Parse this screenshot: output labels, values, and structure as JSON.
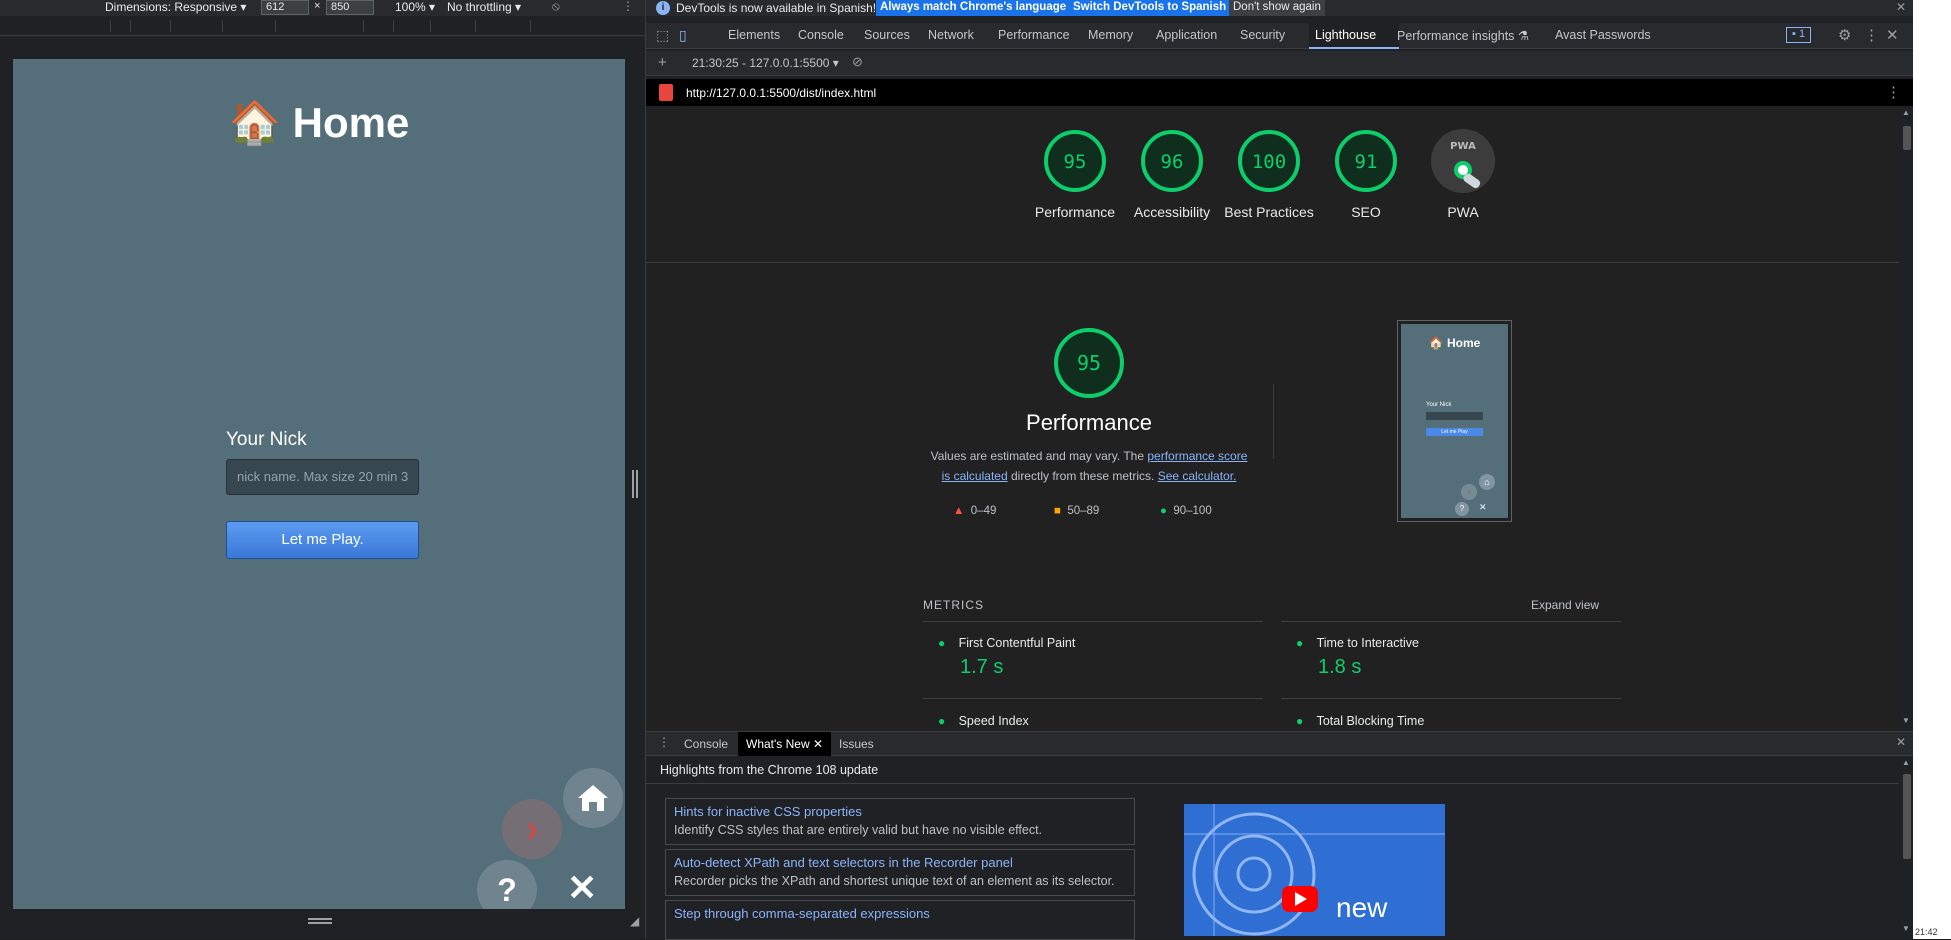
{
  "emulation": {
    "dimensions_label": "Dimensions: Responsive",
    "width_value": "612",
    "times": "×",
    "height_value": "850",
    "zoom": "100%",
    "throttling": "No throttling"
  },
  "page": {
    "title": "Home",
    "title_emoji": "🏠",
    "nick_label": "Your Nick",
    "nick_placeholder": "nick name. Max size 20 min 3",
    "play_button": "Let me Play.",
    "close_glyph": "✕",
    "help_glyph": "?",
    "next_glyph": "›"
  },
  "devtools": {
    "info_bar": {
      "message": "DevTools is now available in Spanish!",
      "btn_match": "Always match Chrome's language",
      "btn_switch": "Switch DevTools to Spanish",
      "btn_dismiss": "Don't show again"
    },
    "tabs": [
      "Elements",
      "Console",
      "Sources",
      "Network",
      "Performance",
      "Memory",
      "Application",
      "Security",
      "Lighthouse",
      "Performance insights",
      "Avast Passwords"
    ],
    "active_tab": "Lighthouse",
    "issues_count": "1",
    "report_selector": "21:30:25 - 127.0.0.1:5500",
    "url": "http://127.0.0.1:5500/dist/index.html",
    "gauges": [
      {
        "score": "95",
        "label": "Performance"
      },
      {
        "score": "96",
        "label": "Accessibility"
      },
      {
        "score": "100",
        "label": "Best Practices"
      },
      {
        "score": "91",
        "label": "SEO"
      },
      {
        "score": "",
        "label": "PWA"
      }
    ],
    "pwa_badge_text": "PWA",
    "performance": {
      "score": "95",
      "title": "Performance",
      "desc_prefix": "Values are estimated and may vary. The ",
      "desc_link1": "performance score is calculated",
      "desc_middle": " directly from these metrics. ",
      "desc_link2": "See calculator.",
      "legend": [
        "0–49",
        "50–89",
        "90–100"
      ]
    },
    "thumbnail": {
      "title": "Home",
      "label": "Your Nick",
      "button": "Let me Play"
    },
    "metrics": {
      "heading": "METRICS",
      "expand": "Expand view",
      "items": [
        {
          "name": "First Contentful Paint",
          "value": "1.7 s"
        },
        {
          "name": "Time to Interactive",
          "value": "1.8 s"
        },
        {
          "name": "Speed Index",
          "value": ""
        },
        {
          "name": "Total Blocking Time",
          "value": ""
        }
      ]
    },
    "drawer": {
      "tabs": [
        "Console",
        "What's New",
        "Issues"
      ],
      "active": "What's New",
      "heading": "Highlights from the Chrome 108 update",
      "news": [
        {
          "title": "Hints for inactive CSS properties",
          "desc": "Identify CSS styles that are entirely valid but have no visible effect."
        },
        {
          "title": "Auto-detect XPath and text selectors in the Recorder panel",
          "desc": "Recorder picks the XPath and shortest unique text of an element as its selector."
        },
        {
          "title": "Step through comma-separated expressions",
          "desc": ""
        }
      ],
      "video_word": "new"
    }
  },
  "taskbar": {
    "clock": "21:42"
  },
  "colors": {
    "good": "#0cce6b",
    "average": "#ffa400",
    "fail": "#ff4e42",
    "link": "#8ab4f8"
  }
}
